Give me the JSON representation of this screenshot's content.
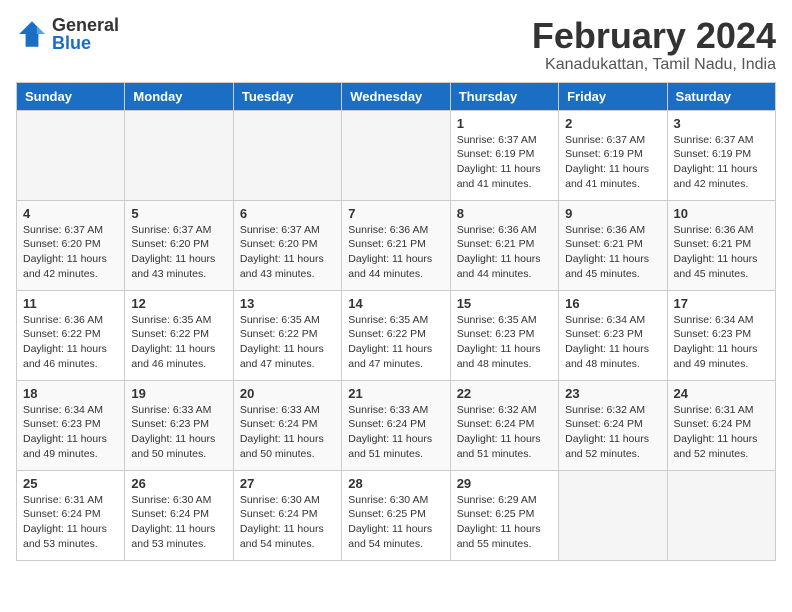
{
  "header": {
    "logo_general": "General",
    "logo_blue": "Blue",
    "title": "February 2024",
    "subtitle": "Kanadukattan, Tamil Nadu, India"
  },
  "days_of_week": [
    "Sunday",
    "Monday",
    "Tuesday",
    "Wednesday",
    "Thursday",
    "Friday",
    "Saturday"
  ],
  "weeks": [
    [
      {
        "day": "",
        "info": ""
      },
      {
        "day": "",
        "info": ""
      },
      {
        "day": "",
        "info": ""
      },
      {
        "day": "",
        "info": ""
      },
      {
        "day": "1",
        "info": "Sunrise: 6:37 AM\nSunset: 6:19 PM\nDaylight: 11 hours\nand 41 minutes."
      },
      {
        "day": "2",
        "info": "Sunrise: 6:37 AM\nSunset: 6:19 PM\nDaylight: 11 hours\nand 41 minutes."
      },
      {
        "day": "3",
        "info": "Sunrise: 6:37 AM\nSunset: 6:19 PM\nDaylight: 11 hours\nand 42 minutes."
      }
    ],
    [
      {
        "day": "4",
        "info": "Sunrise: 6:37 AM\nSunset: 6:20 PM\nDaylight: 11 hours\nand 42 minutes."
      },
      {
        "day": "5",
        "info": "Sunrise: 6:37 AM\nSunset: 6:20 PM\nDaylight: 11 hours\nand 43 minutes."
      },
      {
        "day": "6",
        "info": "Sunrise: 6:37 AM\nSunset: 6:20 PM\nDaylight: 11 hours\nand 43 minutes."
      },
      {
        "day": "7",
        "info": "Sunrise: 6:36 AM\nSunset: 6:21 PM\nDaylight: 11 hours\nand 44 minutes."
      },
      {
        "day": "8",
        "info": "Sunrise: 6:36 AM\nSunset: 6:21 PM\nDaylight: 11 hours\nand 44 minutes."
      },
      {
        "day": "9",
        "info": "Sunrise: 6:36 AM\nSunset: 6:21 PM\nDaylight: 11 hours\nand 45 minutes."
      },
      {
        "day": "10",
        "info": "Sunrise: 6:36 AM\nSunset: 6:21 PM\nDaylight: 11 hours\nand 45 minutes."
      }
    ],
    [
      {
        "day": "11",
        "info": "Sunrise: 6:36 AM\nSunset: 6:22 PM\nDaylight: 11 hours\nand 46 minutes."
      },
      {
        "day": "12",
        "info": "Sunrise: 6:35 AM\nSunset: 6:22 PM\nDaylight: 11 hours\nand 46 minutes."
      },
      {
        "day": "13",
        "info": "Sunrise: 6:35 AM\nSunset: 6:22 PM\nDaylight: 11 hours\nand 47 minutes."
      },
      {
        "day": "14",
        "info": "Sunrise: 6:35 AM\nSunset: 6:22 PM\nDaylight: 11 hours\nand 47 minutes."
      },
      {
        "day": "15",
        "info": "Sunrise: 6:35 AM\nSunset: 6:23 PM\nDaylight: 11 hours\nand 48 minutes."
      },
      {
        "day": "16",
        "info": "Sunrise: 6:34 AM\nSunset: 6:23 PM\nDaylight: 11 hours\nand 48 minutes."
      },
      {
        "day": "17",
        "info": "Sunrise: 6:34 AM\nSunset: 6:23 PM\nDaylight: 11 hours\nand 49 minutes."
      }
    ],
    [
      {
        "day": "18",
        "info": "Sunrise: 6:34 AM\nSunset: 6:23 PM\nDaylight: 11 hours\nand 49 minutes."
      },
      {
        "day": "19",
        "info": "Sunrise: 6:33 AM\nSunset: 6:23 PM\nDaylight: 11 hours\nand 50 minutes."
      },
      {
        "day": "20",
        "info": "Sunrise: 6:33 AM\nSunset: 6:24 PM\nDaylight: 11 hours\nand 50 minutes."
      },
      {
        "day": "21",
        "info": "Sunrise: 6:33 AM\nSunset: 6:24 PM\nDaylight: 11 hours\nand 51 minutes."
      },
      {
        "day": "22",
        "info": "Sunrise: 6:32 AM\nSunset: 6:24 PM\nDaylight: 11 hours\nand 51 minutes."
      },
      {
        "day": "23",
        "info": "Sunrise: 6:32 AM\nSunset: 6:24 PM\nDaylight: 11 hours\nand 52 minutes."
      },
      {
        "day": "24",
        "info": "Sunrise: 6:31 AM\nSunset: 6:24 PM\nDaylight: 11 hours\nand 52 minutes."
      }
    ],
    [
      {
        "day": "25",
        "info": "Sunrise: 6:31 AM\nSunset: 6:24 PM\nDaylight: 11 hours\nand 53 minutes."
      },
      {
        "day": "26",
        "info": "Sunrise: 6:30 AM\nSunset: 6:24 PM\nDaylight: 11 hours\nand 53 minutes."
      },
      {
        "day": "27",
        "info": "Sunrise: 6:30 AM\nSunset: 6:24 PM\nDaylight: 11 hours\nand 54 minutes."
      },
      {
        "day": "28",
        "info": "Sunrise: 6:30 AM\nSunset: 6:25 PM\nDaylight: 11 hours\nand 54 minutes."
      },
      {
        "day": "29",
        "info": "Sunrise: 6:29 AM\nSunset: 6:25 PM\nDaylight: 11 hours\nand 55 minutes."
      },
      {
        "day": "",
        "info": ""
      },
      {
        "day": "",
        "info": ""
      }
    ]
  ]
}
